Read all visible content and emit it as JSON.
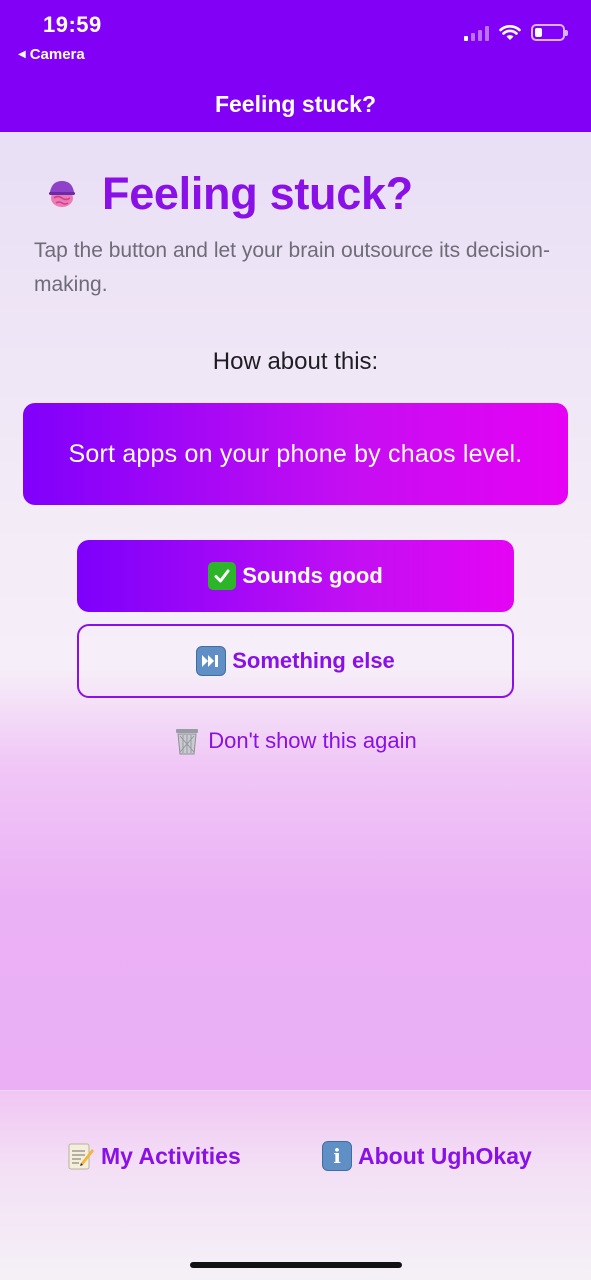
{
  "status_bar": {
    "time": "19:59",
    "back_app": "Camera",
    "back_icon": "back-triangle-icon",
    "battery_level": 0.25
  },
  "nav": {
    "title": "Feeling stuck?"
  },
  "main": {
    "heading": "Feeling stuck?",
    "heading_icon": "brain-icon",
    "subtitle": "Tap the button and let your brain outsource its decision-making.",
    "prompt_label": "How about this:",
    "suggestion": "Sort apps on your phone by chaos level.",
    "primary_button": {
      "icon": "check-mark-icon",
      "label": "Sounds good"
    },
    "secondary_button": {
      "icon": "next-track-icon",
      "label": "Something else"
    },
    "hide_link": {
      "icon": "trash-can-icon",
      "label": "Don't show this again"
    }
  },
  "tabs": [
    {
      "icon": "memo-icon",
      "label": "My Activities"
    },
    {
      "icon": "info-icon",
      "label": "About UghOkay"
    }
  ],
  "colors": {
    "brand": "#8300f7",
    "accent_text": "#8a10e8",
    "gradient_end": "#e602f4"
  }
}
